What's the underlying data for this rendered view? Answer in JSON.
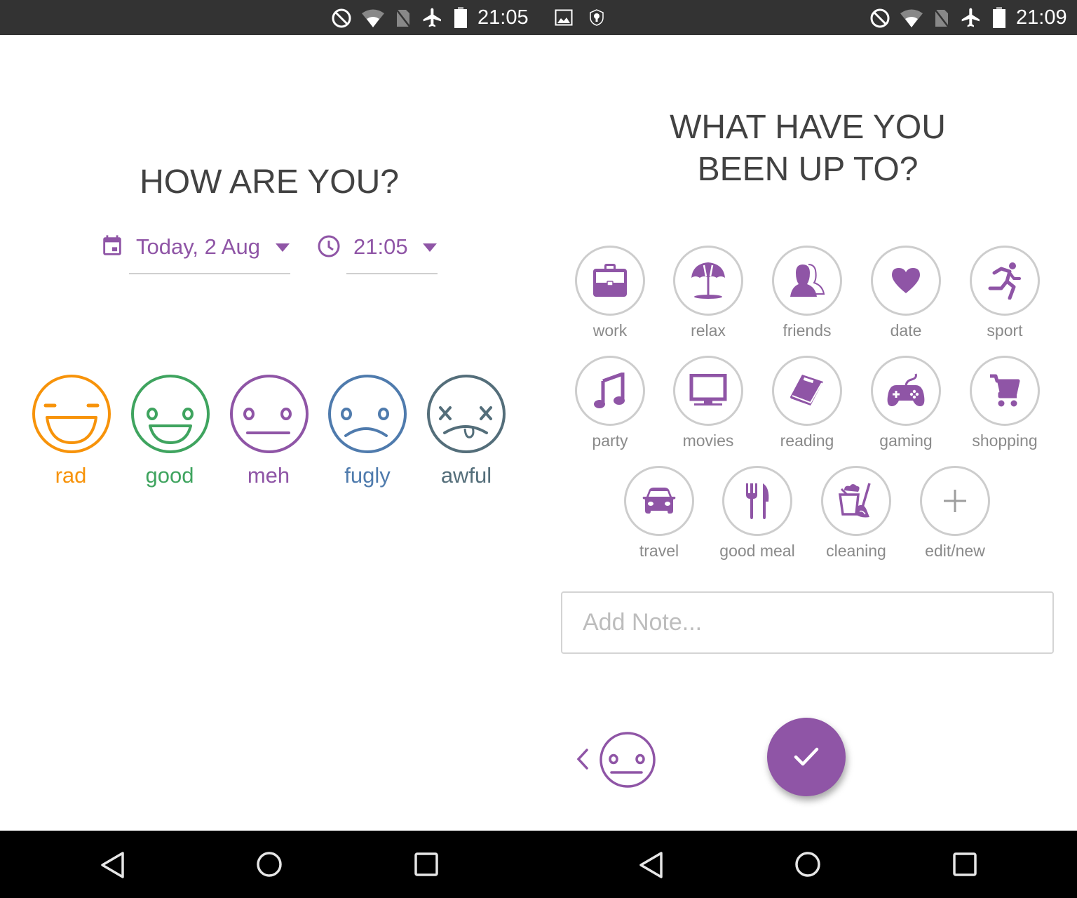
{
  "colors": {
    "accent": "#8f55a6",
    "rad": "#f7930a",
    "good": "#3fa45f",
    "meh": "#8f55a6",
    "fugly": "#4f7bad",
    "awful": "#546e7a",
    "status_bar": "#333333",
    "nav_bar": "#000000"
  },
  "left": {
    "status_bar": {
      "time": "21:05",
      "icons": [
        "do-not-disturb-icon",
        "wifi-icon",
        "no-sim-icon",
        "airplane-mode-icon",
        "battery-icon"
      ]
    },
    "title": "HOW ARE YOU?",
    "date_picker": {
      "icon": "calendar-icon",
      "value": "Today, 2 Aug"
    },
    "time_picker": {
      "icon": "clock-icon",
      "value": "21:05"
    },
    "moods": [
      {
        "id": "rad",
        "label": "rad",
        "icon": "laughing-face-icon"
      },
      {
        "id": "good",
        "label": "good",
        "icon": "smiling-face-icon"
      },
      {
        "id": "meh",
        "label": "meh",
        "icon": "neutral-face-icon"
      },
      {
        "id": "fugly",
        "label": "fugly",
        "icon": "sad-face-icon"
      },
      {
        "id": "awful",
        "label": "awful",
        "icon": "dead-face-icon"
      }
    ],
    "nav_bar": [
      "back-icon",
      "home-icon",
      "recents-icon"
    ]
  },
  "right": {
    "status_bar": {
      "time": "21:09",
      "notification_icons": [
        "image-icon",
        "vpn-shield-icon"
      ],
      "icons": [
        "do-not-disturb-icon",
        "wifi-icon",
        "no-sim-icon",
        "airplane-mode-icon",
        "battery-icon"
      ]
    },
    "title_line1": "WHAT HAVE YOU",
    "title_line2": "BEEN UP TO?",
    "activities": [
      {
        "label": "work",
        "icon": "briefcase-icon"
      },
      {
        "label": "relax",
        "icon": "beach-umbrella-icon"
      },
      {
        "label": "friends",
        "icon": "friends-icon"
      },
      {
        "label": "date",
        "icon": "heart-icon"
      },
      {
        "label": "sport",
        "icon": "running-icon"
      },
      {
        "label": "party",
        "icon": "music-note-icon"
      },
      {
        "label": "movies",
        "icon": "monitor-icon"
      },
      {
        "label": "reading",
        "icon": "book-icon"
      },
      {
        "label": "gaming",
        "icon": "gamepad-icon"
      },
      {
        "label": "shopping",
        "icon": "cart-icon"
      },
      {
        "label": "travel",
        "icon": "car-icon"
      },
      {
        "label": "good meal",
        "icon": "fork-knife-icon"
      },
      {
        "label": "cleaning",
        "icon": "cleaning-bucket-icon"
      },
      {
        "label": "edit/new",
        "icon": "plus-icon"
      }
    ],
    "note": {
      "placeholder": "Add Note...",
      "value": ""
    },
    "selected_mood": {
      "id": "meh",
      "icon": "neutral-face-icon"
    },
    "back_icon": "chevron-left-icon",
    "save_icon": "check-icon",
    "nav_bar": [
      "back-icon",
      "home-icon",
      "recents-icon"
    ]
  }
}
